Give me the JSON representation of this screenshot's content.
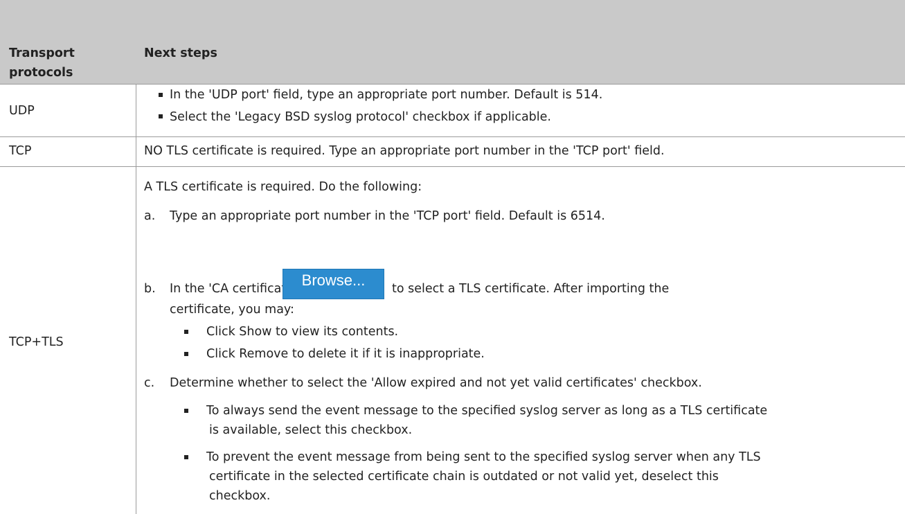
{
  "header": {
    "col1_line1": "Transport",
    "col1_line2": "protocols",
    "col2": "Next steps"
  },
  "rows": {
    "udp": {
      "protocol": "UDP",
      "bullets": [
        "In the 'UDP port' field, type an appropriate port number. Default is 514.",
        "Select the 'Legacy BSD syslog protocol' checkbox if applicable."
      ]
    },
    "tcp": {
      "protocol": "TCP",
      "text": "NO TLS certificate is required. Type an appropriate port number in the 'TCP port' field."
    },
    "tcptls": {
      "protocol": "TCP+TLS",
      "intro": "A TLS certificate is required. Do the following:",
      "step_a_letter": "a.",
      "step_a": "Type an appropriate port number in the 'TCP port' field. Default is 6514.",
      "step_b_letter": "b.",
      "step_b_before": "In the 'CA certificate' field, click",
      "browse_label": "Browse...",
      "step_b_after": "to select a TLS certificate. After importing the",
      "step_b_line2": "certificate, you may:",
      "step_b_bullets": [
        "Click Show to view its contents.",
        "Click Remove to delete it if it is inappropriate."
      ],
      "step_c_letter": "c.",
      "step_c": "Determine whether to select the 'Allow expired and not yet valid certificates' checkbox.",
      "step_c_bullet1_line1": "To always send the event message to the specified syslog server as long as a TLS certificate",
      "step_c_bullet1_line2": "is available, select this checkbox.",
      "step_c_bullet2_line1": "To prevent the event message from being sent to the specified syslog server when any TLS",
      "step_c_bullet2_line2": "certificate in the selected certificate chain is outdated or not valid yet, deselect this",
      "step_c_bullet2_line3": "checkbox."
    }
  }
}
